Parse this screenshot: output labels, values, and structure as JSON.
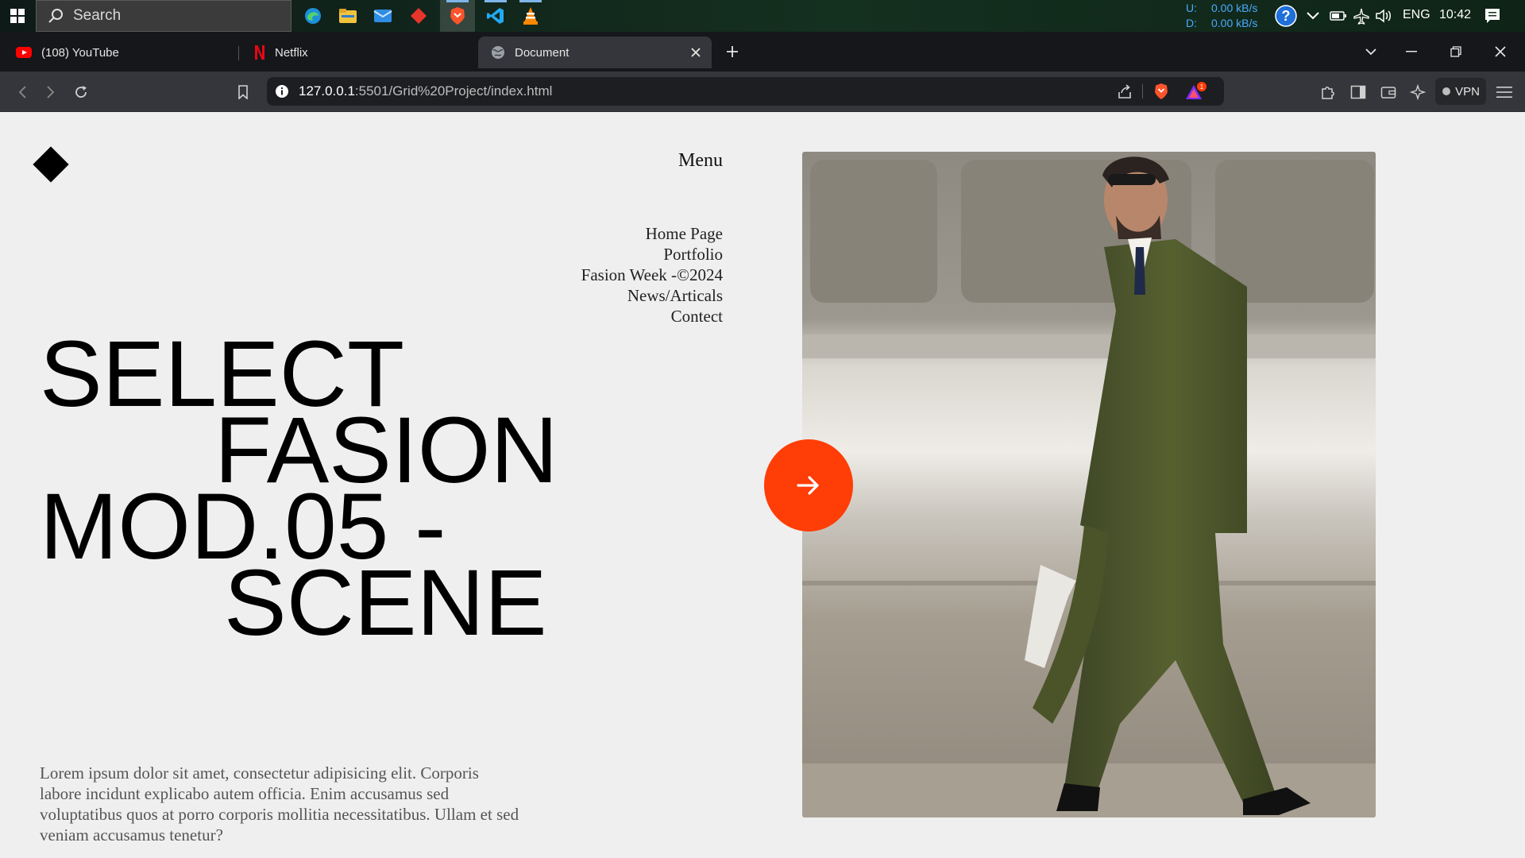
{
  "taskbar": {
    "search_label": "Search",
    "net": {
      "up_label": "U:",
      "up_value": "0.00 kB/s",
      "down_label": "D:",
      "down_value": "0.00 kB/s"
    },
    "language": "ENG",
    "time": "10:42",
    "apps": [
      "edge-icon",
      "file-explorer-icon",
      "mail-icon",
      "red-diamond-app-icon",
      "brave-icon",
      "vscode-icon",
      "vlc-icon"
    ]
  },
  "browser": {
    "tabs": [
      {
        "label": "(108) YouTube",
        "icon": "youtube-icon"
      },
      {
        "label": "Netflix",
        "icon": "netflix-icon"
      },
      {
        "label": "Document",
        "icon": "globe-icon",
        "active": true
      }
    ],
    "url_host": "127.0.0.1",
    "url_path": ":5501/Grid%20Project/index.html",
    "brave_badge": "1",
    "vpn_label": "VPN"
  },
  "page": {
    "menu_title": "Menu",
    "menu_items": [
      "Home Page",
      "Portfolio",
      "Fasion Week -©2024",
      "News/Articals",
      "Contect"
    ],
    "headline": [
      "SELECT",
      "FASION",
      "MOD.05 -",
      "SCENE"
    ],
    "lorem": "Lorem ipsum dolor sit amet, consectetur adipisicing elit. Corporis labore incidunt explicabo autem officia. Enim accusamus sed voluptatibus quos at porro corporis mollitia necessitatibus. Ullam et sed veniam accusamus tenetur?",
    "accent_color": "#ff3d06"
  }
}
